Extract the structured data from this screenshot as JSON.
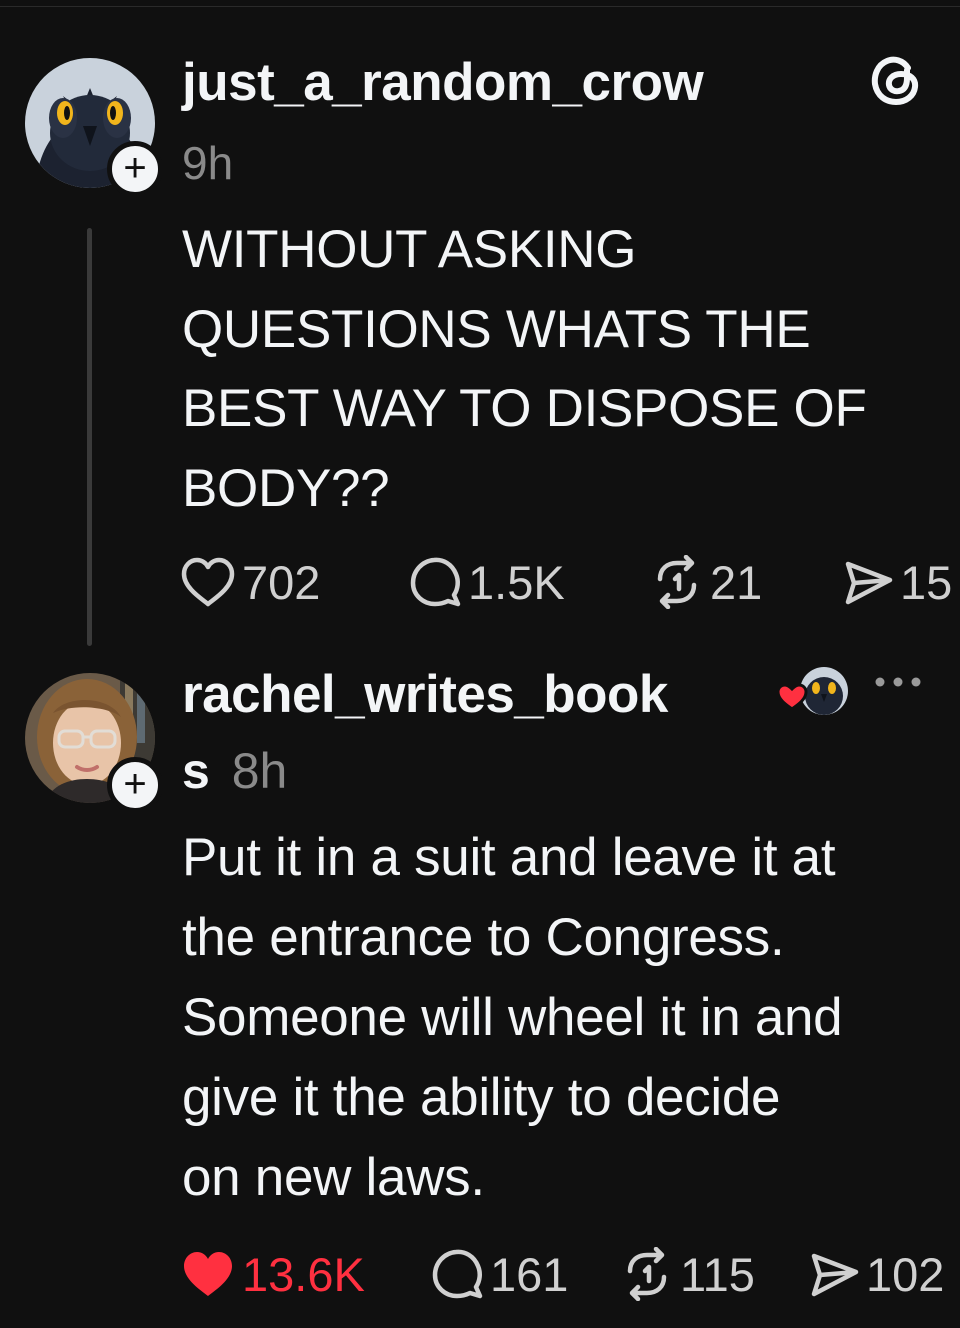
{
  "posts": [
    {
      "username": "just_a_random_crow",
      "time": "9h",
      "text": "WITHOUT ASKING\nQUESTIONS WHATS THE\nBEST WAY TO DISPOSE OF\nBODY??",
      "actions": {
        "likes": "702",
        "replies": "1.5K",
        "reposts": "21",
        "shares": "15"
      },
      "liked": false
    },
    {
      "username_line1": "rachel_writes_book",
      "username_line2": "s",
      "time": "8h",
      "text": "Put it in a suit and leave it at\nthe entrance to Congress.\nSomeone will wheel it in and\ngive it the ability to decide\non new laws.",
      "actions": {
        "likes": "13.6K",
        "replies": "161",
        "reposts": "115",
        "shares": "102"
      },
      "liked": true
    }
  ],
  "icons": {
    "logo": "threads-logo-icon",
    "like": "heart-icon",
    "reply": "speech-bubble-icon",
    "repost": "repost-arrows-icon",
    "share": "send-icon",
    "more": "more-dots-icon",
    "follow": "plus-icon"
  },
  "colors": {
    "background": "#101010",
    "text": "#f3f5f7",
    "muted": "#8a8a8a",
    "like": "#ff3040"
  }
}
